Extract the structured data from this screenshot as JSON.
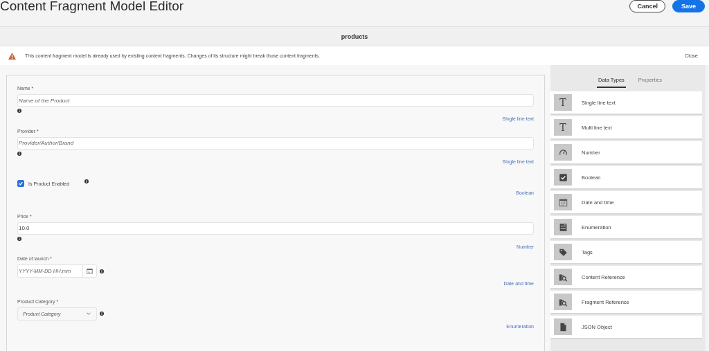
{
  "header": {
    "title": "Content Fragment Model Editor",
    "buttons": [
      {
        "label": "Cancel",
        "kind": "secondary"
      },
      {
        "label": "Save",
        "kind": "primary"
      }
    ]
  },
  "model_name": "products",
  "alert": {
    "message": "This content fragment model is already used by existing content fragments. Changes of its structure might break those content fragments.",
    "close": "Close"
  },
  "fields": [
    {
      "kind": "text",
      "label": "Name *",
      "placeholder": "Name of the Product",
      "type": "Single line text"
    },
    {
      "kind": "text",
      "label": "Provider *",
      "placeholder": "Provider/Author/Brand",
      "type": "Single line text"
    },
    {
      "kind": "checkbox",
      "label": "Is Product Enabled",
      "checked": true,
      "type": "Boolean"
    },
    {
      "kind": "text",
      "label": "Price *",
      "value": "10.0",
      "type": "Number"
    },
    {
      "kind": "date",
      "label": "Date of launch *",
      "placeholder": "YYYY-MM-DD HH:mm",
      "type": "Date and time"
    },
    {
      "kind": "select",
      "label": "Product Category *",
      "placeholder": "Product Category",
      "type": "Enumeration"
    }
  ],
  "tabs": [
    {
      "label": "Data Types",
      "selected": true
    },
    {
      "label": "Properties",
      "selected": false
    }
  ],
  "data_types": [
    {
      "kind": "text",
      "glyph": "T",
      "label": "Single line text"
    },
    {
      "kind": "text",
      "glyph": "T",
      "label": "Multi line text"
    },
    {
      "kind": "number",
      "label": "Number"
    },
    {
      "kind": "boolean",
      "label": "Boolean"
    },
    {
      "kind": "date",
      "label": "Date and time"
    },
    {
      "kind": "enumeration",
      "label": "Enumeration"
    },
    {
      "kind": "tags",
      "label": "Tags"
    },
    {
      "kind": "reference",
      "label": "Content Reference"
    },
    {
      "kind": "reference",
      "label": "Fragment Reference"
    },
    {
      "kind": "json",
      "label": "JSON Object"
    }
  ]
}
